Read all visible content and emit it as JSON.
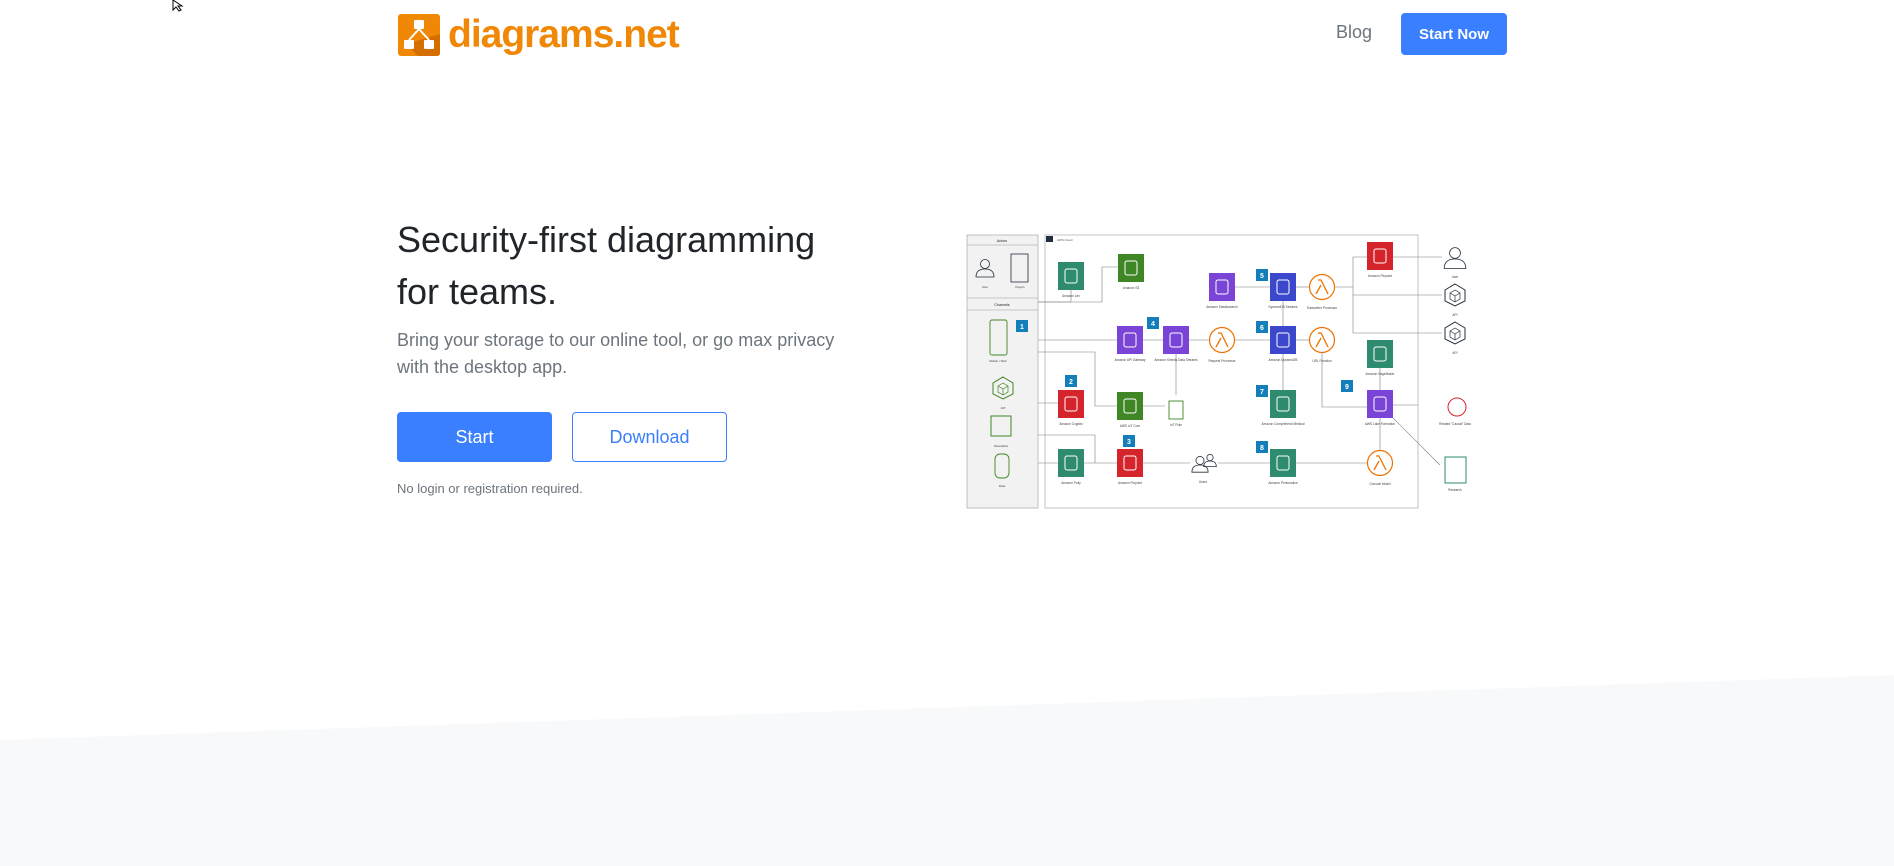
{
  "header": {
    "logo_text": "diagrams.net",
    "blog_label": "Blog",
    "start_now_label": "Start Now"
  },
  "hero": {
    "title": "Security-first diagramming for teams.",
    "lead": "Bring your storage to our online tool, or go max privacy with the desktop app.",
    "start_label": "Start",
    "download_label": "Download",
    "note": "No login or registration required."
  },
  "colors": {
    "brand": "#f08705",
    "accent": "#3a7fff",
    "footer_bg": "#f8f9fa",
    "badge": "#147EBA"
  },
  "diagram": {
    "actors_title": "Actors",
    "channels_title": "Channels",
    "cloud_title": "AWS Cloud",
    "actors": [
      "User",
      "Payers"
    ],
    "channels": [
      "Mobile / Web",
      "API",
      "Wearables",
      "Data"
    ],
    "badges": [
      "1",
      "2",
      "3",
      "4",
      "5",
      "6",
      "7",
      "8",
      "9"
    ],
    "nodes": {
      "lex": "Amazon Lex",
      "s3": "Amazon S3",
      "apigw": "Amazon API Gateway",
      "kinesis": "Amazon Kinesis Data Streams",
      "req": "Request Processor",
      "es": "Amazon Elasticsearch",
      "ddbs": "DynamoDB Streams",
      "sub": "Subscriber Processor",
      "ddb": "Amazon DynamoDB",
      "url": "URL Function",
      "pin1": "Amazon Pinpoint",
      "user": "User",
      "api1": "API",
      "api2": "API",
      "sage": "Amazon SageMaker",
      "lake": "AWS Lake Formation",
      "rel": "Related \"Causal\" Data",
      "res": "Research",
      "comp": "Amazon Comprehend Medical",
      "pers": "Amazon Personalize",
      "cons": "Console Model",
      "users": "Users",
      "pin2": "Amazon Pinpoint",
      "polly": "Amazon Polly",
      "cog": "Amazon Cognito",
      "iot": "AWS IoT Core",
      "rule": "IoT Rule"
    }
  }
}
